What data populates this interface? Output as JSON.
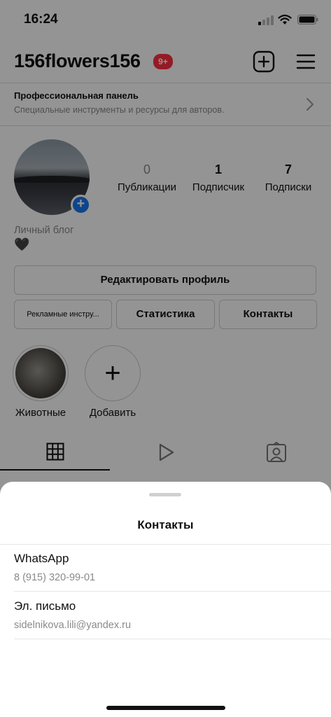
{
  "status_bar": {
    "time": "16:24"
  },
  "header": {
    "username": "156flowers156",
    "notifications_badge": "9+"
  },
  "pro_panel": {
    "title": "Профессиональная панель",
    "subtitle": "Специальные инструменты и ресурсы для авторов."
  },
  "profile": {
    "stats": [
      {
        "value": "0",
        "label": "Публикации"
      },
      {
        "value": "1",
        "label": "Подписчик"
      },
      {
        "value": "7",
        "label": "Подписки"
      }
    ],
    "category": "Личный блог",
    "bio_emoji": "🖤"
  },
  "buttons": {
    "edit_profile": "Редактировать профиль",
    "ad_tools": "Рекламные инстру...",
    "statistics": "Статистика",
    "contacts": "Контакты"
  },
  "highlights": [
    {
      "label": "Животные"
    },
    {
      "label": "Добавить"
    }
  ],
  "tabs": [
    "grid-icon",
    "reels-icon",
    "tagged-icon"
  ],
  "contacts_sheet": {
    "title": "Контакты",
    "items": [
      {
        "label": "WhatsApp",
        "value": "8 (915) 320-99-01"
      },
      {
        "label": "Эл. письмо",
        "value": "sidelnikova.lili@yandex.ru"
      }
    ]
  },
  "colors": {
    "accent_blue": "#1877f2",
    "badge_red": "#ff3040"
  }
}
